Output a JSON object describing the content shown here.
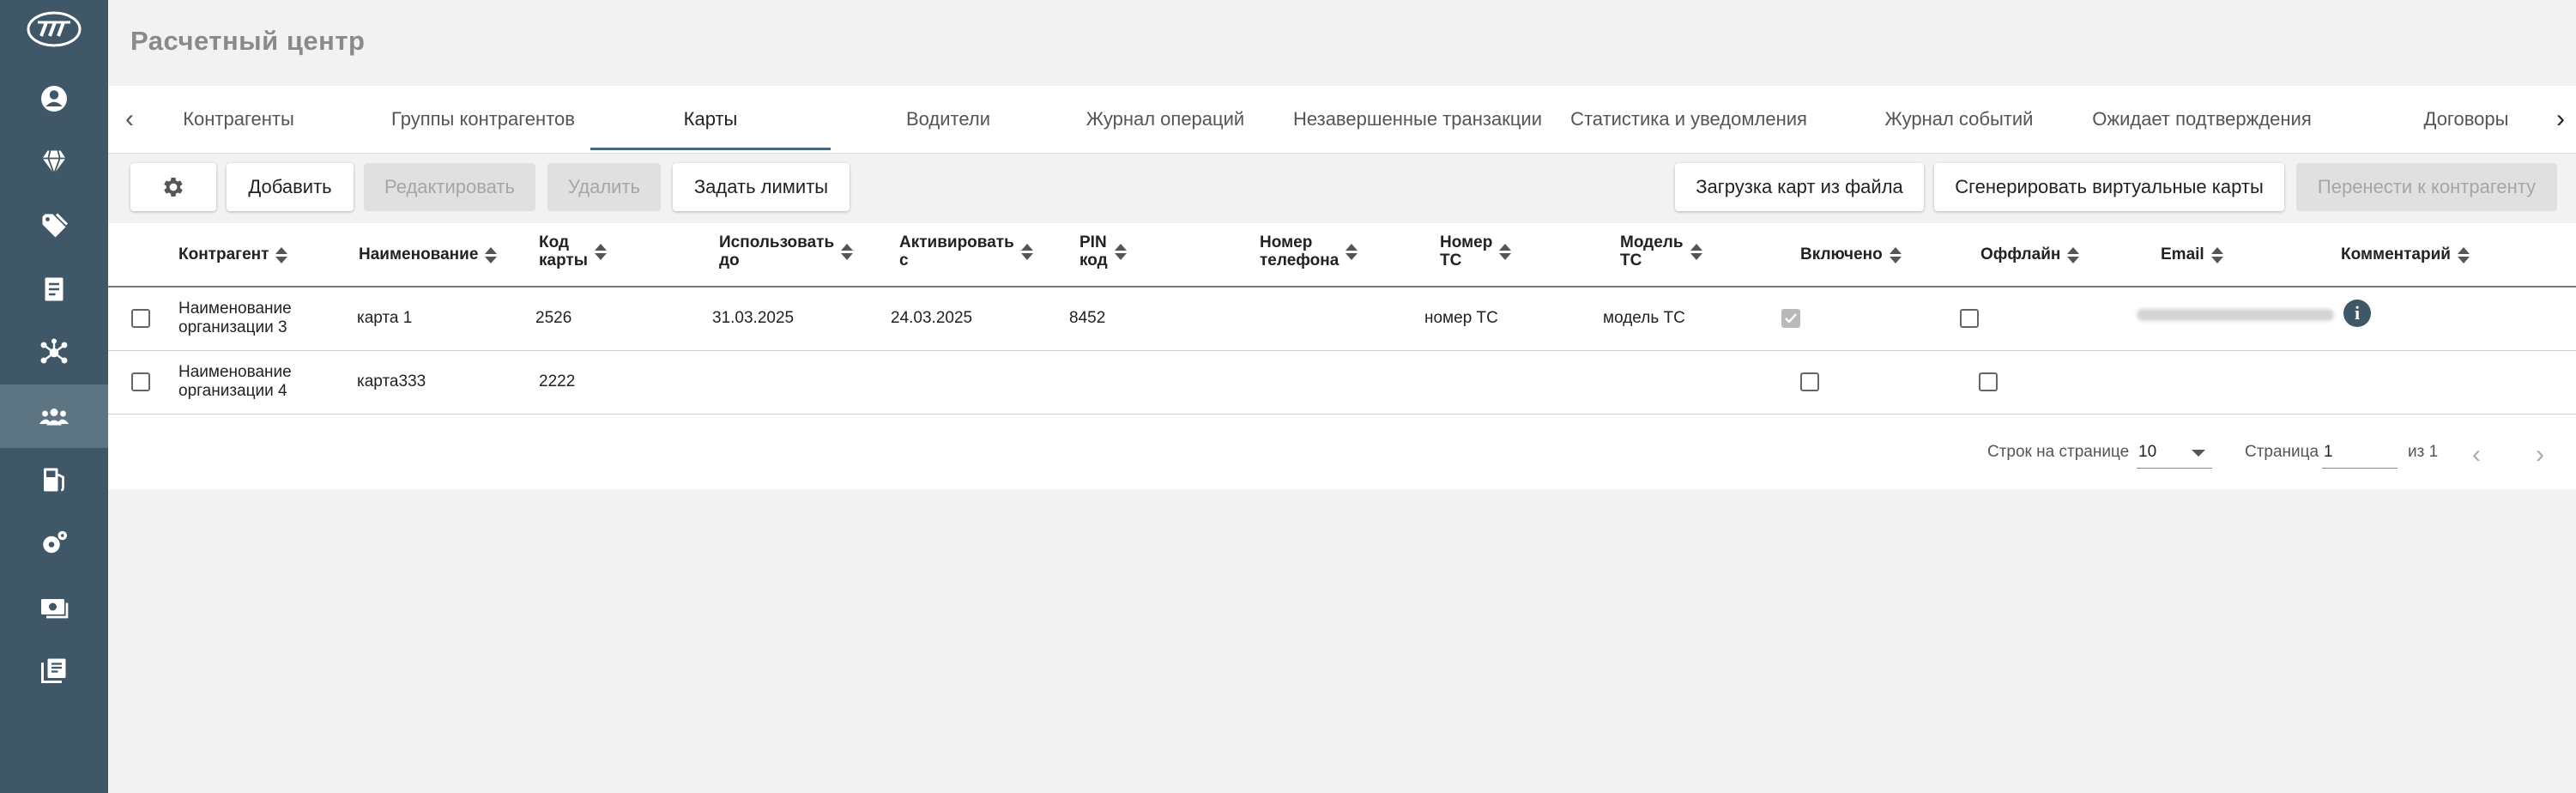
{
  "app": {
    "title": "Расчетный центр"
  },
  "tabs": [
    {
      "label": "Контрагенты"
    },
    {
      "label": "Группы контрагентов"
    },
    {
      "label": "Карты"
    },
    {
      "label": "Водители"
    },
    {
      "label": "Журнал операций"
    },
    {
      "label": "Незавершенные транзакции"
    },
    {
      "label": "Статистика и уведомления"
    },
    {
      "label": "Журнал событий"
    },
    {
      "label": "Ожидает подтверждения"
    },
    {
      "label": "Договоры"
    }
  ],
  "active_tab": "Карты",
  "toolbar": {
    "add": "Добавить",
    "edit": "Редактировать",
    "delete": "Удалить",
    "limits": "Задать лимиты",
    "upload": "Загрузка карт из файла",
    "generate": "Сгенерировать виртуальные карты",
    "transfer": "Перенести к контрагенту"
  },
  "table": {
    "headers": {
      "counterparty": "Контрагент",
      "name": "Наименование",
      "code_1": "Код",
      "code_2": "карты",
      "use_1": "Использовать",
      "use_2": "до",
      "activate_1": "Активировать",
      "activate_2": "с",
      "pin_1": "PIN",
      "pin_2": "код",
      "phone_1": "Номер",
      "phone_2": "телефона",
      "vehicle_1": "Номер",
      "vehicle_2": "ТС",
      "model_1": "Модель",
      "model_2": "ТС",
      "enabled": "Включено",
      "offline": "Оффлайн",
      "email": "Email",
      "comment": "Комментарий"
    },
    "rows": [
      {
        "counterparty_1": "Наименование",
        "counterparty_2": "организации 3",
        "name": "карта 1",
        "code": "2526",
        "use_until": "31.03.2025",
        "activate_from": "24.03.2025",
        "pin": "8452",
        "phone": "",
        "vehicle": "номер ТС",
        "model": "модель ТС",
        "enabled": true,
        "offline": false
      },
      {
        "counterparty_1": "Наименование",
        "counterparty_2": "организации 4",
        "name": "карта333",
        "code": "2222",
        "use_until": "",
        "activate_from": "",
        "pin": "",
        "phone": "",
        "vehicle": "",
        "model": "",
        "enabled": false,
        "offline": false
      }
    ]
  },
  "pagination": {
    "rows_per_page_label": "Строк на странице",
    "rows_per_page": "10",
    "page_label": "Страница",
    "page": "1",
    "of_label": "из 1"
  }
}
